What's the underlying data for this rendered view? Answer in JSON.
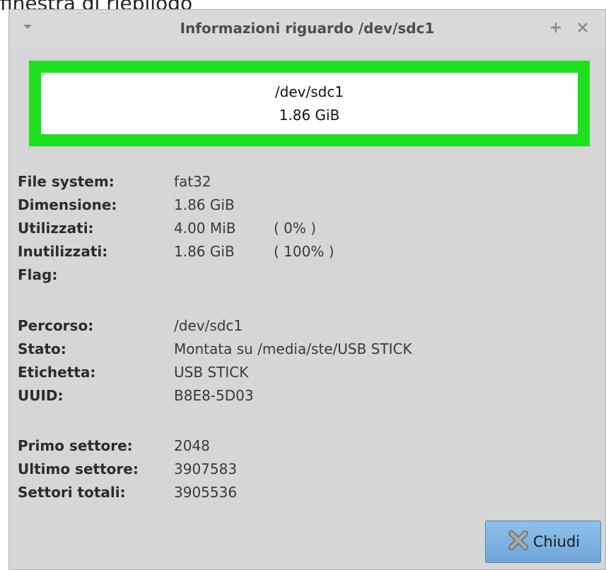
{
  "caption": "finestra di riepilogo",
  "window": {
    "title": "Informazioni riguardo /dev/sdc1",
    "menu_icon": "chevron-down-icon",
    "maximize_icon": "plus-icon",
    "close_icon": "close-icon"
  },
  "partition": {
    "path": "/dev/sdc1",
    "size": "1.86 GiB",
    "border_color": "#1ee01e"
  },
  "usage": {
    "filesystem_label": "File system:",
    "filesystem_value": "fat32",
    "size_label": "Dimensione:",
    "size_value": "1.86 GiB",
    "used_label": "Utilizzati:",
    "used_value": "4.00 MiB",
    "used_percent": "( 0% )",
    "unused_label": "Inutilizzati:",
    "unused_value": "1.86 GiB",
    "unused_percent": "( 100% )",
    "flag_label": "Flag:",
    "flag_value": ""
  },
  "details": {
    "path_label": "Percorso:",
    "path_value": "/dev/sdc1",
    "status_label": "Stato:",
    "status_value": "Montata su /media/ste/USB STICK",
    "label_label": "Etichetta:",
    "label_value": "USB STICK",
    "uuid_label": "UUID:",
    "uuid_value": "B8E8-5D03"
  },
  "sectors": {
    "first_label": "Primo settore:",
    "first_value": "2048",
    "last_label": "Ultimo settore:",
    "last_value": "3907583",
    "total_label": "Settori totali:",
    "total_value": "3905536"
  },
  "buttons": {
    "close_label": "Chiudi",
    "close_icon": "close-x-icon"
  }
}
